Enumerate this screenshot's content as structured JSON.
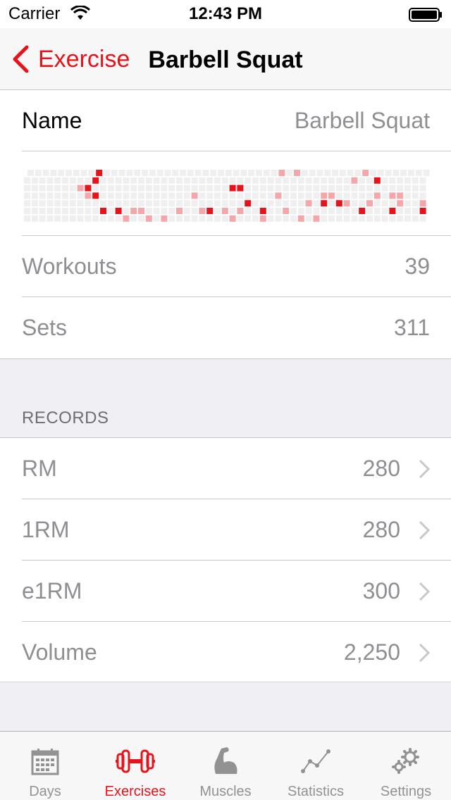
{
  "status_bar": {
    "carrier": "Carrier",
    "time": "12:43 PM"
  },
  "nav": {
    "back_label": "Exercise",
    "title": "Barbell Squat"
  },
  "info": {
    "name_label": "Name",
    "name_value": "Barbell Squat",
    "workouts_label": "Workouts",
    "workouts_value": "39",
    "sets_label": "Sets",
    "sets_value": "311"
  },
  "records": {
    "header": "RECORDS",
    "items": [
      {
        "label": "RM",
        "value": "280"
      },
      {
        "label": "1RM",
        "value": "280"
      },
      {
        "label": "e1RM",
        "value": "300"
      },
      {
        "label": "Volume",
        "value": "2,250"
      }
    ]
  },
  "tabs": [
    {
      "label": "Days",
      "icon": "calendar-icon",
      "active": false
    },
    {
      "label": "Exercises",
      "icon": "dumbbell-icon",
      "active": true
    },
    {
      "label": "Muscles",
      "icon": "muscle-arm-icon",
      "active": false
    },
    {
      "label": "Statistics",
      "icon": "line-graph-icon",
      "active": false
    },
    {
      "label": "Settings",
      "icon": "gear-icon",
      "active": false
    }
  ],
  "colors": {
    "accent": "#e8121a",
    "light_accent": "#f4a6a8",
    "empty_cell": "#efefef"
  },
  "heatmap": {
    "rows": 7,
    "columns": 53,
    "dark_cells": [
      [
        9,
        0
      ],
      [
        9,
        1
      ],
      [
        8,
        2
      ],
      [
        9,
        3
      ],
      [
        10,
        5
      ],
      [
        12,
        5
      ],
      [
        28,
        2
      ],
      [
        29,
        4
      ],
      [
        31,
        5
      ],
      [
        39,
        4
      ],
      [
        41,
        4
      ],
      [
        44,
        5
      ],
      [
        46,
        1
      ],
      [
        48,
        5
      ],
      [
        52,
        5
      ],
      [
        27,
        2
      ],
      [
        24,
        5
      ]
    ],
    "light_cells": [
      [
        7,
        2
      ],
      [
        8,
        3
      ],
      [
        13,
        6
      ],
      [
        14,
        5
      ],
      [
        15,
        5
      ],
      [
        16,
        6
      ],
      [
        18,
        6
      ],
      [
        20,
        5
      ],
      [
        22,
        3
      ],
      [
        23,
        5
      ],
      [
        26,
        5
      ],
      [
        28,
        5
      ],
      [
        33,
        3
      ],
      [
        34,
        5
      ],
      [
        37,
        4
      ],
      [
        39,
        3
      ],
      [
        40,
        3
      ],
      [
        42,
        4
      ],
      [
        45,
        4
      ],
      [
        46,
        3
      ],
      [
        48,
        3
      ],
      [
        49,
        3
      ],
      [
        52,
        4
      ],
      [
        31,
        6
      ],
      [
        36,
        6
      ],
      [
        38,
        6
      ],
      [
        43,
        1
      ],
      [
        44,
        0
      ],
      [
        45,
        4
      ],
      [
        49,
        4
      ],
      [
        33,
        0
      ],
      [
        35,
        0
      ],
      [
        27,
        6
      ]
    ]
  }
}
